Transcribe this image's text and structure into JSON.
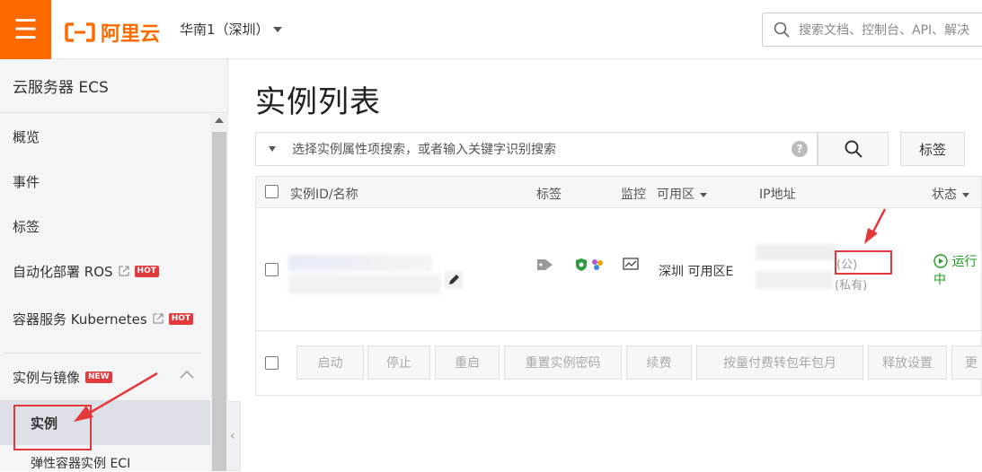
{
  "topbar": {
    "brand": "阿里云",
    "region": "华南1（深圳）",
    "search_placeholder": "搜索文档、控制台、API、解决"
  },
  "sidebar": {
    "title": "云服务器 ECS",
    "items": [
      {
        "label": "概览"
      },
      {
        "label": "事件"
      },
      {
        "label": "标签"
      },
      {
        "label": "自动化部署 ROS",
        "badge": "HOT"
      },
      {
        "label": "容器服务 Kubernetes",
        "badge": "HOT"
      }
    ],
    "group": {
      "label": "实例与镜像",
      "badge": "NEW"
    },
    "active": "实例",
    "sub_partial": "弹性容器实例 ECI"
  },
  "main": {
    "title": "实例列表",
    "filter_placeholder": "选择实例属性项搜索，或者输入关键字识别搜索",
    "tag_button": "标签",
    "columns": {
      "id_name": "实例ID/名称",
      "tags": "标签",
      "monitor": "监控",
      "zone": "可用区",
      "ip": "IP地址",
      "status": "状态"
    },
    "row": {
      "zone": "深圳 可用区E",
      "ip_public_suffix": "(公)",
      "ip_private_suffix": "(私有)",
      "status": "运行中"
    },
    "actions": [
      "启动",
      "停止",
      "重启",
      "重置实例密码",
      "续费",
      "按量付费转包年包月",
      "释放设置",
      "更"
    ]
  },
  "colors": {
    "brand": "#ff6a00",
    "annotation_red": "#e4393c",
    "running_green": "#1e9e1e"
  }
}
